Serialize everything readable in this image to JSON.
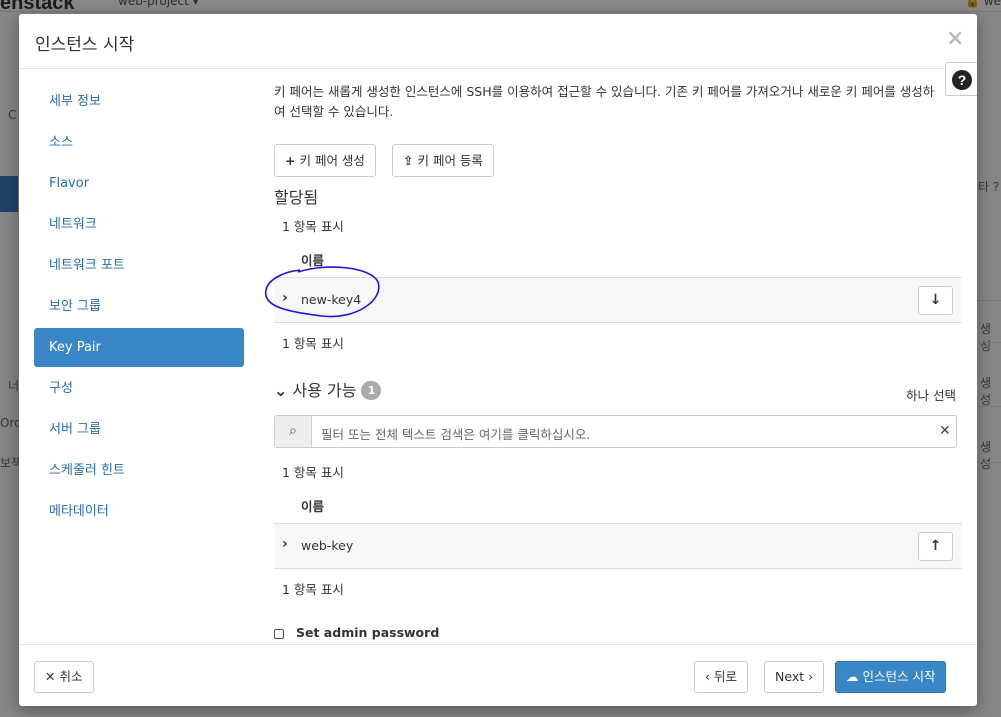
{
  "background": {
    "logo": "enstack",
    "project": "web-project ▾",
    "user": "🔒 we",
    "fragments": [
      "C",
      "타 ?",
      "생성",
      "생성",
      "생성",
      "너",
      "Orch",
      "보책"
    ]
  },
  "modal": {
    "title": "인스턴스 시작",
    "close_icon": "×",
    "help_icon": "?"
  },
  "sidebar": {
    "items": [
      {
        "label": "세부 정보"
      },
      {
        "label": "소스"
      },
      {
        "label": "Flavor"
      },
      {
        "label": "네트워크"
      },
      {
        "label": "네트워크 포트"
      },
      {
        "label": "보안 그룹"
      },
      {
        "label": "Key Pair",
        "active": true
      },
      {
        "label": "구성"
      },
      {
        "label": "서버 그룹"
      },
      {
        "label": "스케줄러 힌트"
      },
      {
        "label": "메타데이터"
      }
    ]
  },
  "content": {
    "intro": "키 페어는 새롭게 생성한 인스턴스에 SSH를 이용하여 접근할 수 있습니다. 기존 키 페어를 가져오거나 새로운 키 페어를 생성하여 선택할 수 있습니다.",
    "create_button": "키 페어 생성",
    "import_button": "키 페어 등록",
    "allocated": {
      "heading": "할당됨",
      "count_top": "1 항목 표시",
      "column_name": "이름",
      "rows": [
        {
          "name": "new-key4"
        }
      ],
      "count_bottom": "1 항목 표시"
    },
    "available": {
      "heading": "사용 가능",
      "badge": "1",
      "select_one": "하나 선택",
      "filter_placeholder": "필터 또는 전체 텍스트 검색은 여기를 클릭하십시오.",
      "count_top": "1 항목 표시",
      "column_name": "이름",
      "rows": [
        {
          "name": "web-key"
        }
      ],
      "count_bottom": "1 항목 표시"
    },
    "admin_password_label": "Set admin password"
  },
  "footer": {
    "cancel": "취소",
    "back": "‹ 뒤로",
    "next": "Next ›",
    "launch": "인스턴스 시작"
  },
  "colors": {
    "primary": "#3a87c8",
    "link": "#2a6dab",
    "annotation": "#1a1adf"
  }
}
